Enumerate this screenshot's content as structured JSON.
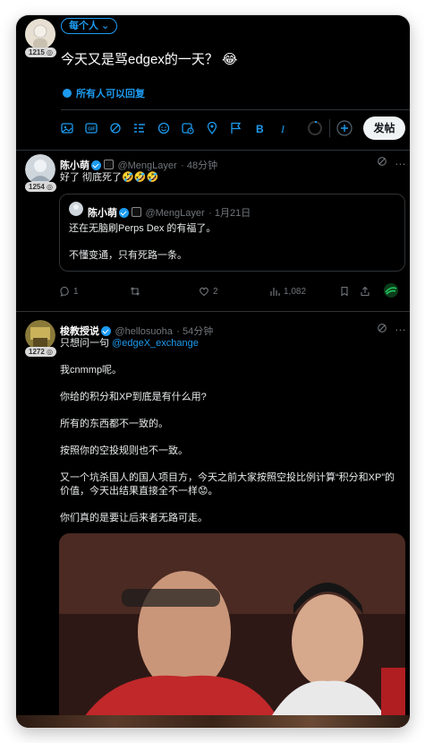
{
  "composer": {
    "avatar_badge": "1215 ◎",
    "audience_label": "每个人 ⌄",
    "text": "今天又是骂edgex的一天？ 😂",
    "reply_setting": "所有人可以回复",
    "post_button": "发帖"
  },
  "tweets": [
    {
      "name": "陈小萌",
      "handle": "@MengLayer",
      "time": "48分钟",
      "badge": "1254 ◎",
      "text": "好了 彻底死了🤣🤣🤣",
      "quote": {
        "name": "陈小萌",
        "handle": "@MengLayer",
        "time": "1月21日",
        "line1": "还在无脑刷Perps Dex 的有福了。",
        "line2": "不懂变通，只有死路一条。"
      },
      "actions": {
        "replies": "1",
        "retweets": "",
        "likes": "2",
        "views": "1,082"
      }
    },
    {
      "name": "梭教授说",
      "handle": "@hellosuoha",
      "time": "54分钟",
      "badge": "1272 ◎",
      "line_intro": "只想问一句",
      "mention": "@edgeX_exchange",
      "paragraphs": [
        "我cnmmp呢。",
        "你给的积分和XP到底是有什么用?",
        "所有的东西都不一致的。",
        "按照你的空投规则也不一致。",
        "又一个坑杀国人的国人项目方，今天之前大家按照空投比例计算“积分和XP”的",
        "价值，今天出结果直接全不一样😟。",
        "你们真的是要让后来者无路可走。"
      ]
    }
  ],
  "icons": {
    "more": "…",
    "colors": {
      "accent": "#1d9bf0",
      "background": "#000000",
      "muted": "#71767b",
      "divider": "#2f3336"
    }
  }
}
